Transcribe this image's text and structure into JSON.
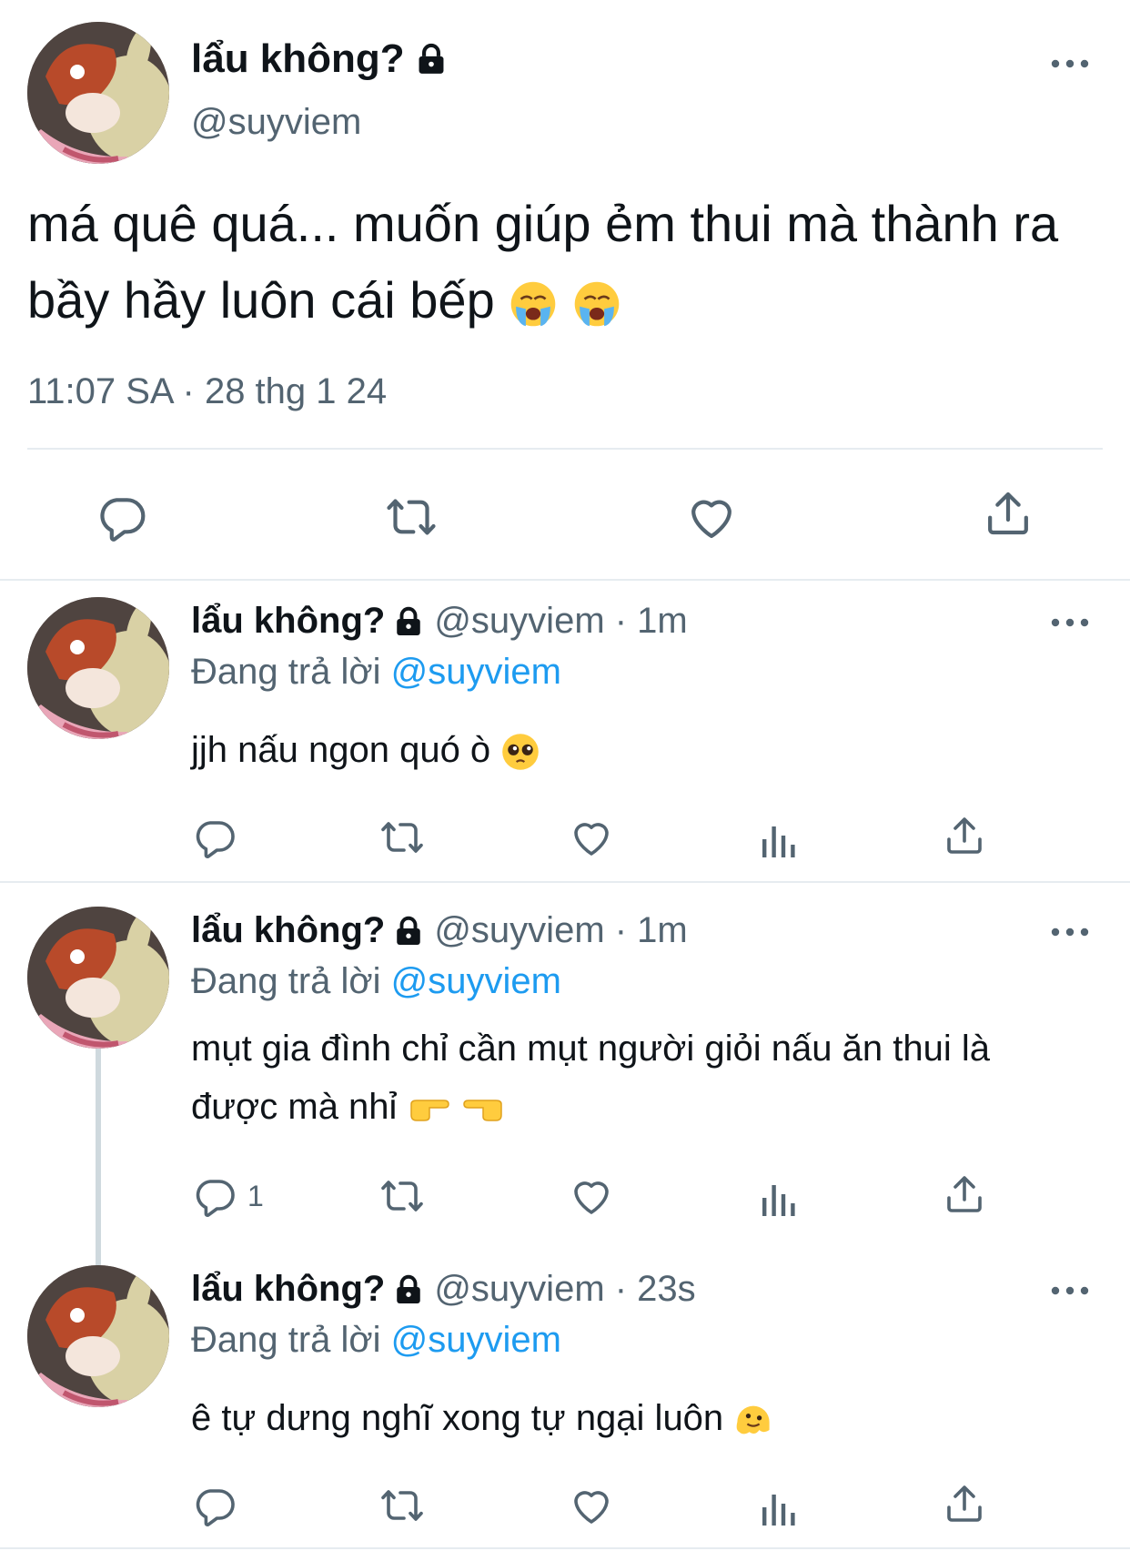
{
  "main_tweet": {
    "name": "lẩu không?",
    "handle": "@suyviem",
    "text": "má quê quá... muốn giúp ẻm thui mà thành ra bầy hầy luôn cái bếp",
    "emoji": [
      "loudly-crying-face",
      "loudly-crying-face"
    ],
    "meta": "11:07 SA · 28 thg 1 24",
    "actions": [
      "reply",
      "retweet",
      "like",
      "share"
    ]
  },
  "replies": [
    {
      "name": "lẩu không?",
      "handle_time": "@suyviem · 1m",
      "replying_prefix": "Đang trả lời",
      "replying_to": "@suyviem",
      "text": "jjh nấu ngon quó ò",
      "emoji": [
        "pleading-face"
      ],
      "reply_count": ""
    },
    {
      "name": "lẩu không?",
      "handle_time": "@suyviem · 1m",
      "replying_prefix": "Đang trả lời",
      "replying_to": "@suyviem",
      "text": "mụt gia đình chỉ cần mụt người giỏi nấu ăn thui là được mà nhỉ",
      "emoji": [
        "pointing-right",
        "pointing-left"
      ],
      "reply_count": "1"
    },
    {
      "name": "lẩu không?",
      "handle_time": "@suyviem · 23s",
      "replying_prefix": "Đang trả lời",
      "replying_to": "@suyviem",
      "text": "ê tự dưng nghĩ xong tự ngại luôn",
      "emoji": [
        "melting-face"
      ],
      "reply_count": ""
    }
  ],
  "colors": {
    "text": "#0f1419",
    "secondary": "#536471",
    "link": "#1d9bf0",
    "divider": "#e6ecf0"
  }
}
